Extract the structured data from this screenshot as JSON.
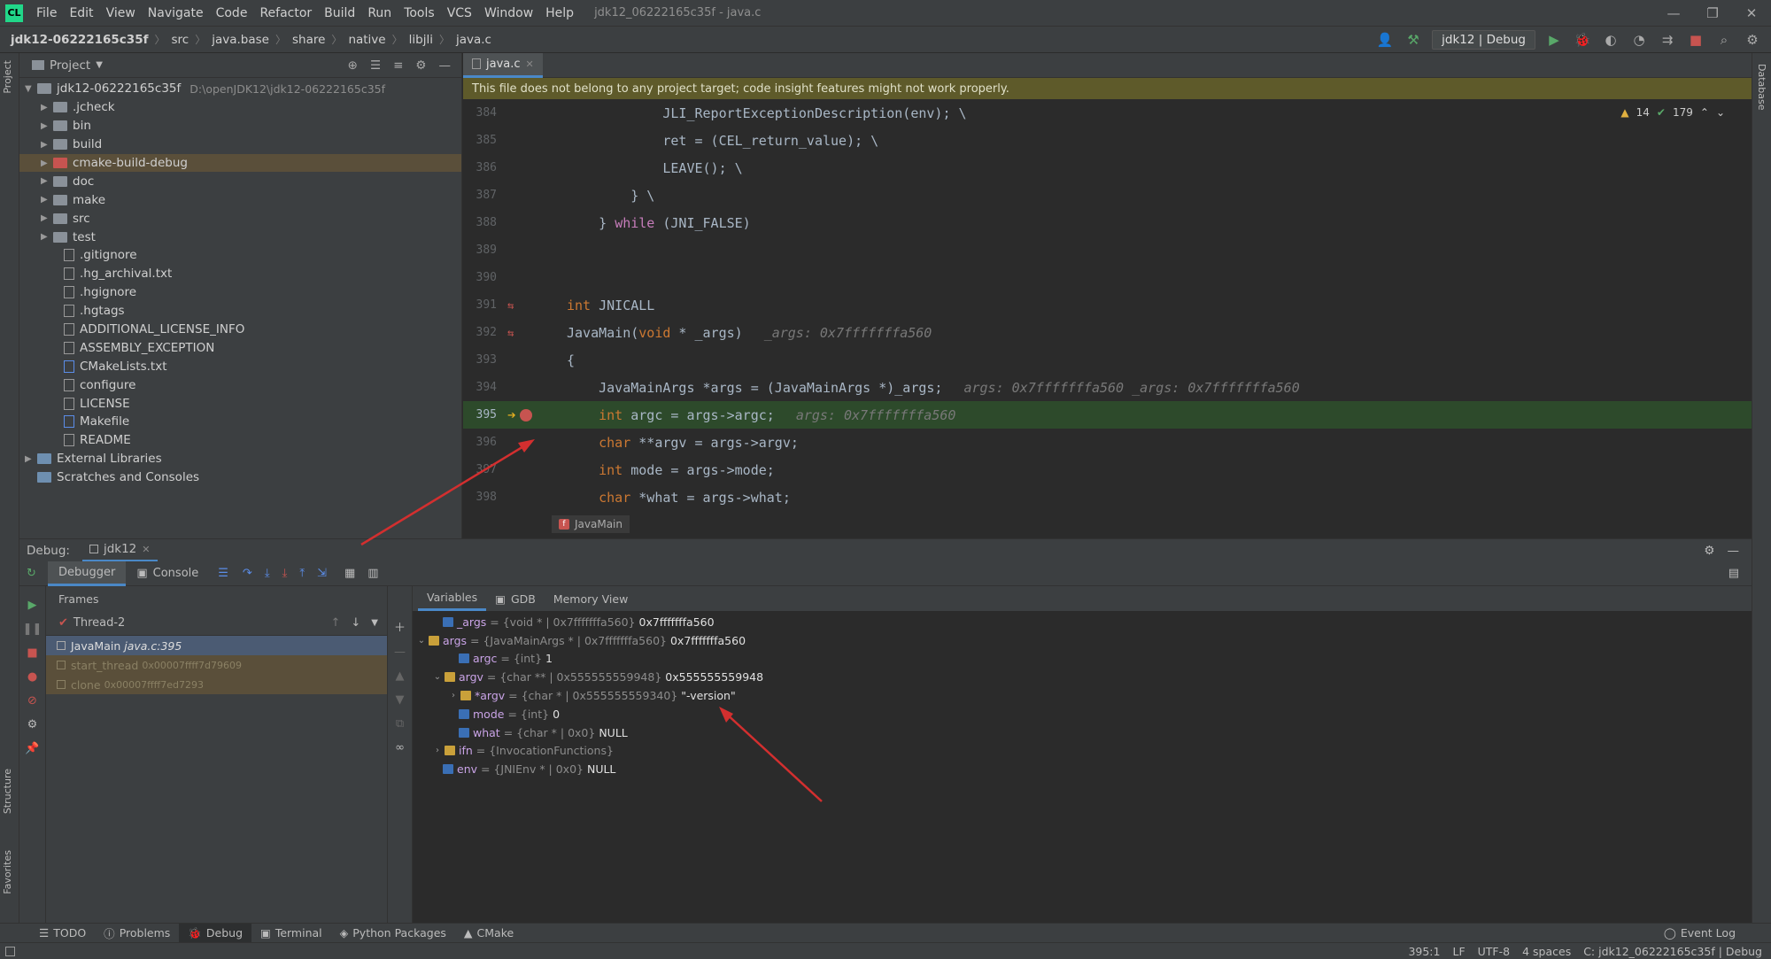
{
  "menubar": {
    "logo": "CL",
    "items": [
      "File",
      "Edit",
      "View",
      "Navigate",
      "Code",
      "Refactor",
      "Build",
      "Run",
      "Tools",
      "VCS",
      "Window",
      "Help"
    ],
    "window_title": "jdk12_06222165c35f - java.c",
    "controls": [
      "—",
      "❐",
      "✕"
    ]
  },
  "navbar": {
    "crumbs": [
      "jdk12-06222165c35f",
      "src",
      "java.base",
      "share",
      "native",
      "libjli",
      "java.c"
    ],
    "run_config": "jdk12 | Debug"
  },
  "left_tabs": {
    "project": "Project",
    "structure": "Structure",
    "favorites": "Favorites"
  },
  "right_tabs": {
    "database": "Database"
  },
  "project": {
    "title": "Project",
    "root": {
      "name": "jdk12-06222165c35f",
      "path": "D:\\openJDK12\\jdk12-06222165c35f"
    },
    "items": [
      {
        "name": ".jcheck",
        "kind": "folder"
      },
      {
        "name": "bin",
        "kind": "folder"
      },
      {
        "name": "build",
        "kind": "folder"
      },
      {
        "name": "cmake-build-debug",
        "kind": "folder-red"
      },
      {
        "name": "doc",
        "kind": "folder"
      },
      {
        "name": "make",
        "kind": "folder"
      },
      {
        "name": "src",
        "kind": "folder"
      },
      {
        "name": "test",
        "kind": "folder"
      },
      {
        "name": ".gitignore",
        "kind": "file"
      },
      {
        "name": ".hg_archival.txt",
        "kind": "file"
      },
      {
        "name": ".hgignore",
        "kind": "file"
      },
      {
        "name": ".hgtags",
        "kind": "file"
      },
      {
        "name": "ADDITIONAL_LICENSE_INFO",
        "kind": "file"
      },
      {
        "name": "ASSEMBLY_EXCEPTION",
        "kind": "file"
      },
      {
        "name": "CMakeLists.txt",
        "kind": "file"
      },
      {
        "name": "configure",
        "kind": "file"
      },
      {
        "name": "LICENSE",
        "kind": "file"
      },
      {
        "name": "Makefile",
        "kind": "file"
      },
      {
        "name": "README",
        "kind": "file"
      }
    ],
    "external": "External Libraries",
    "scratches": "Scratches and Consoles"
  },
  "editor": {
    "tab": "java.c",
    "warning": "This file does not belong to any project target; code insight features might not work properly.",
    "inspections": {
      "warnings": "14",
      "ok": "179"
    },
    "lines": [
      {
        "n": "384",
        "code": "            JLI_ReportExceptionDescription(env); \\",
        "hint": ""
      },
      {
        "n": "385",
        "code": "            ret = (CEL_return_value); \\",
        "hint": ""
      },
      {
        "n": "386",
        "code": "            LEAVE(); \\",
        "hint": ""
      },
      {
        "n": "387",
        "code": "        } \\",
        "hint": ""
      },
      {
        "n": "388",
        "code": "    } while (JNI_FALSE)",
        "hint": ""
      },
      {
        "n": "389",
        "code": "",
        "hint": ""
      },
      {
        "n": "390",
        "code": "",
        "hint": ""
      },
      {
        "n": "391",
        "code": "int JNICALL",
        "hint": ""
      },
      {
        "n": "392",
        "code": "JavaMain(void * _args)",
        "hint": "_args: 0x7fffffffa560"
      },
      {
        "n": "393",
        "code": "{",
        "hint": ""
      },
      {
        "n": "394",
        "code": "    JavaMainArgs *args = (JavaMainArgs *)_args;",
        "hint": "args: 0x7fffffffa560   _args: 0x7fffffffa560"
      },
      {
        "n": "395",
        "code": "    int argc = args->argc;",
        "hint": "args: 0x7fffffffa560"
      },
      {
        "n": "396",
        "code": "    char **argv = args->argv;",
        "hint": ""
      },
      {
        "n": "397",
        "code": "    int mode = args->mode;",
        "hint": ""
      },
      {
        "n": "398",
        "code": "    char *what = args->what;",
        "hint": ""
      }
    ],
    "current_function": "JavaMain"
  },
  "debug": {
    "title": "Debug:",
    "session": "jdk12",
    "tabs": [
      "Debugger",
      "Console"
    ],
    "frames_header": "Frames",
    "thread": "Thread-2",
    "frames": [
      {
        "name": "JavaMain",
        "loc": "java.c:395"
      },
      {
        "name": "start_thread",
        "loc": "0x00007ffff7d79609"
      },
      {
        "name": "clone",
        "loc": "0x00007ffff7ed7293"
      }
    ],
    "var_tabs": [
      "Variables",
      "GDB",
      "Memory View"
    ],
    "variables": [
      {
        "indent": 0,
        "arrow": "",
        "icon": "var",
        "name": "_args",
        "type": "= {void * | 0x7fffffffa560}",
        "value": "0x7fffffffa560"
      },
      {
        "indent": 0,
        "arrow": "⌄",
        "icon": "arr",
        "name": "args",
        "type": "= {JavaMainArgs * | 0x7fffffffa560}",
        "value": "0x7fffffffa560"
      },
      {
        "indent": 1,
        "arrow": "",
        "icon": "var",
        "name": "argc",
        "type": "= {int}",
        "value": "1"
      },
      {
        "indent": 1,
        "arrow": "⌄",
        "icon": "arr",
        "name": "argv",
        "type": "= {char ** | 0x555555559948}",
        "value": "0x555555559948"
      },
      {
        "indent": 2,
        "arrow": "›",
        "icon": "arr",
        "name": "*argv",
        "type": "= {char * | 0x555555559340}",
        "value": "\"-version\""
      },
      {
        "indent": 1,
        "arrow": "",
        "icon": "var",
        "name": "mode",
        "type": "= {int}",
        "value": "0"
      },
      {
        "indent": 1,
        "arrow": "",
        "icon": "var",
        "name": "what",
        "type": "= {char * | 0x0}",
        "value": "NULL"
      },
      {
        "indent": 1,
        "arrow": "›",
        "icon": "arr",
        "name": "ifn",
        "type": "= {InvocationFunctions}",
        "value": ""
      },
      {
        "indent": 0,
        "arrow": "",
        "icon": "var",
        "name": "env",
        "type": "= {JNIEnv * | 0x0}",
        "value": "NULL"
      }
    ]
  },
  "bottom_tabs": [
    "TODO",
    "Problems",
    "Debug",
    "Terminal",
    "Python Packages",
    "CMake"
  ],
  "event_log": "Event Log",
  "status": {
    "pos": "395:1",
    "eol": "LF",
    "enc": "UTF-8",
    "indent": "4 spaces",
    "context": "C: jdk12_06222165c35f | Debug"
  }
}
